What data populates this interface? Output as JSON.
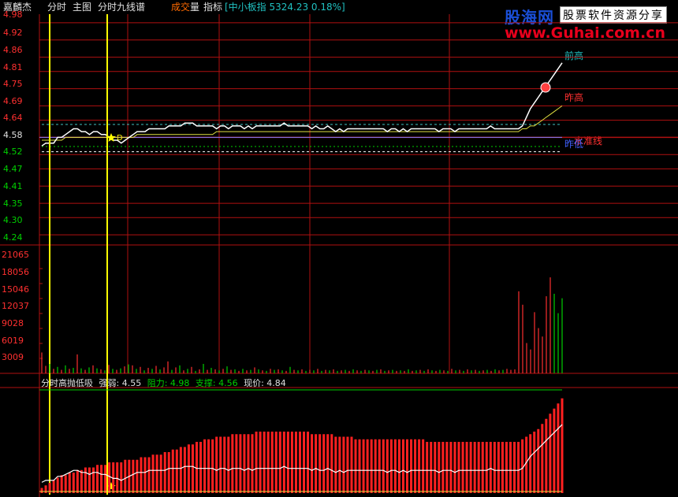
{
  "header": {
    "stock_name": "嘉麟杰",
    "menu": [
      "分时",
      "主图",
      "分时九线谱"
    ],
    "volume_menu_a": "成交",
    "volume_menu_b": "量",
    "indicator_menu": "指标",
    "index_box": "[中小板指 5324.23 0.18%]"
  },
  "logo": {
    "big": "股海网",
    "box": "股票软件资源分享",
    "url": "www.Guhai.com.cn"
  },
  "colors": {
    "price_up": "#ff3030",
    "price_down": "#00d000",
    "price_line": "#ffffff",
    "avg_line": "#e0e040",
    "grid": "#b01010",
    "marker": "#ffff00",
    "cyan": "#20c0c0"
  },
  "chart_data": [
    {
      "type": "line",
      "title": "",
      "price_ticks_up": [
        "4.98",
        "4.92",
        "4.86",
        "4.81",
        "4.75",
        "4.69",
        "4.64"
      ],
      "price_tick_mid": "4.58",
      "price_ticks_down": [
        "4.52",
        "4.47",
        "4.41",
        "4.35",
        "4.30",
        "4.24"
      ],
      "ylim": [
        4.21,
        5.01
      ],
      "prev_close": 4.58,
      "series": [
        {
          "values": [
            4.55,
            4.56,
            4.56,
            4.56,
            4.58,
            4.58,
            4.59,
            4.6,
            4.61,
            4.61,
            4.6,
            4.6,
            4.59,
            4.6,
            4.6,
            4.59,
            4.59,
            4.58,
            4.57,
            4.57,
            4.56,
            4.57,
            4.58,
            4.59,
            4.6,
            4.6,
            4.6,
            4.61,
            4.61,
            4.61,
            4.61,
            4.61,
            4.62,
            4.62,
            4.62,
            4.62,
            4.63,
            4.63,
            4.63,
            4.62,
            4.62,
            4.62,
            4.62,
            4.62,
            4.61,
            4.62,
            4.62,
            4.61,
            4.62,
            4.62,
            4.62,
            4.61,
            4.62,
            4.61,
            4.62,
            4.62,
            4.62,
            4.62,
            4.62,
            4.62,
            4.62,
            4.63,
            4.62,
            4.62,
            4.62,
            4.62,
            4.62,
            4.62,
            4.61,
            4.62,
            4.61,
            4.61,
            4.62,
            4.61,
            4.6,
            4.61,
            4.6,
            4.61,
            4.61,
            4.61,
            4.61,
            4.61,
            4.61,
            4.61,
            4.61,
            4.61,
            4.61,
            4.6,
            4.61,
            4.61,
            4.6,
            4.61,
            4.6,
            4.61,
            4.61,
            4.61,
            4.61,
            4.61,
            4.61,
            4.61,
            4.6,
            4.61,
            4.61,
            4.61,
            4.6,
            4.61,
            4.61,
            4.61,
            4.61,
            4.61,
            4.61,
            4.61,
            4.61,
            4.62,
            4.61,
            4.61,
            4.61,
            4.61,
            4.61,
            4.61,
            4.61,
            4.62,
            4.65,
            4.68,
            4.7,
            4.72,
            4.74,
            4.76,
            4.78,
            4.8,
            4.82,
            4.84
          ]
        },
        {
          "values": [
            4.57,
            4.57,
            4.57,
            4.57,
            4.57,
            4.57,
            4.58,
            4.58,
            4.58,
            4.58,
            4.58,
            4.58,
            4.58,
            4.58,
            4.58,
            4.58,
            4.58,
            4.58,
            4.58,
            4.58,
            4.58,
            4.58,
            4.58,
            4.58,
            4.59,
            4.59,
            4.59,
            4.59,
            4.59,
            4.59,
            4.59,
            4.59,
            4.59,
            4.59,
            4.59,
            4.59,
            4.59,
            4.59,
            4.59,
            4.59,
            4.59,
            4.59,
            4.59,
            4.59,
            4.6,
            4.6,
            4.6,
            4.6,
            4.6,
            4.6,
            4.6,
            4.6,
            4.6,
            4.6,
            4.6,
            4.6,
            4.6,
            4.6,
            4.6,
            4.6,
            4.6,
            4.6,
            4.6,
            4.6,
            4.6,
            4.6,
            4.6,
            4.6,
            4.6,
            4.6,
            4.6,
            4.6,
            4.6,
            4.6,
            4.6,
            4.6,
            4.6,
            4.6,
            4.6,
            4.6,
            4.6,
            4.6,
            4.6,
            4.6,
            4.6,
            4.6,
            4.6,
            4.6,
            4.6,
            4.6,
            4.6,
            4.6,
            4.6,
            4.6,
            4.6,
            4.6,
            4.6,
            4.6,
            4.6,
            4.6,
            4.6,
            4.6,
            4.6,
            4.6,
            4.6,
            4.6,
            4.6,
            4.6,
            4.6,
            4.6,
            4.6,
            4.6,
            4.6,
            4.6,
            4.6,
            4.6,
            4.6,
            4.6,
            4.6,
            4.6,
            4.6,
            4.61,
            4.61,
            4.62,
            4.62,
            4.63,
            4.64,
            4.65,
            4.66,
            4.67,
            4.68,
            4.69
          ]
        }
      ],
      "annotations": {
        "prev_high_label": "前高",
        "yesterday_high_label": "昨高",
        "yesterday_low_label": "昨低",
        "water_line_label": "水准线",
        "d_marker_label": "D"
      }
    },
    {
      "type": "bar",
      "title": "",
      "ticks": [
        "21065",
        "18056",
        "15046",
        "12037",
        "9028",
        "6019",
        "3009"
      ],
      "ylim": [
        0,
        24074
      ],
      "values": [
        4200,
        1500,
        1900,
        900,
        1300,
        700,
        1600,
        900,
        1100,
        3800,
        1000,
        700,
        1200,
        1600,
        1000,
        800,
        600,
        1700,
        900,
        700,
        1000,
        1400,
        1800,
        1600,
        900,
        1300,
        600,
        1100,
        900,
        1500,
        800,
        1200,
        2400,
        700,
        1200,
        1600,
        600,
        900,
        1300,
        500,
        800,
        1900,
        700,
        1100,
        800,
        600,
        900,
        1400,
        700,
        800,
        500,
        900,
        600,
        700,
        1200,
        800,
        600,
        500,
        900,
        700,
        800,
        600,
        500,
        1300,
        700,
        600,
        800,
        500,
        700,
        600,
        900,
        500,
        700,
        600,
        800,
        500,
        600,
        700,
        500,
        800,
        600,
        500,
        700,
        600,
        500,
        700,
        800,
        500,
        600,
        700,
        500,
        600,
        500,
        800,
        500,
        600,
        700,
        500,
        800,
        600,
        500,
        700,
        600,
        500,
        900,
        600,
        700,
        500,
        800,
        600,
        700,
        500,
        600,
        700,
        500,
        800,
        600,
        700,
        900,
        700,
        800,
        16500,
        13800,
        6100,
        4800,
        12300,
        9100,
        7400,
        15500,
        19300,
        16000,
        12100,
        15100
      ],
      "up": [
        true,
        true,
        false,
        true,
        false,
        true,
        false,
        true,
        false,
        true,
        false,
        true,
        false,
        true,
        false,
        true,
        false,
        true,
        false,
        true,
        false,
        true,
        false,
        true,
        false,
        true,
        false,
        true,
        false,
        true,
        false,
        true,
        true,
        false,
        true,
        false,
        true,
        false,
        true,
        false,
        true,
        false,
        true,
        false,
        true,
        false,
        true,
        false,
        true,
        false,
        true,
        false,
        true,
        false,
        true,
        false,
        true,
        false,
        true,
        false,
        true,
        false,
        true,
        false,
        true,
        false,
        true,
        false,
        true,
        false,
        true,
        false,
        true,
        false,
        true,
        false,
        true,
        false,
        true,
        false,
        true,
        false,
        true,
        false,
        true,
        false,
        true,
        false,
        true,
        false,
        true,
        false,
        true,
        false,
        true,
        false,
        true,
        false,
        true,
        false,
        true,
        false,
        true,
        false,
        true,
        false,
        true,
        false,
        true,
        false,
        true,
        false,
        true,
        false,
        true,
        false,
        true,
        false,
        true,
        true,
        true,
        true,
        true,
        true,
        true,
        true,
        true,
        true,
        true,
        true
      ]
    },
    {
      "type": "bar",
      "title": "",
      "indicator_name": "分时高抛低吸",
      "strength_label": "强弱: 4.55",
      "resistance_label": "阻力: 4.98",
      "support_label": "支撑: 4.56",
      "price_label": "现价: 4.84",
      "values": [
        2,
        3,
        4,
        5,
        6,
        7,
        7,
        8,
        8,
        9,
        9,
        10,
        10,
        10,
        11,
        11,
        11,
        12,
        12,
        12,
        12,
        13,
        13,
        13,
        13,
        14,
        14,
        14,
        15,
        15,
        15,
        16,
        16,
        17,
        17,
        18,
        18,
        19,
        19,
        20,
        20,
        21,
        21,
        21,
        22,
        22,
        22,
        22,
        23,
        23,
        23,
        23,
        23,
        23,
        24,
        24,
        24,
        24,
        24,
        24,
        24,
        24,
        24,
        24,
        24,
        24,
        24,
        24,
        23,
        23,
        23,
        23,
        23,
        23,
        22,
        22,
        22,
        22,
        22,
        21,
        21,
        21,
        21,
        21,
        21,
        21,
        21,
        21,
        21,
        21,
        21,
        21,
        21,
        21,
        21,
        21,
        21,
        20,
        20,
        20,
        20,
        20,
        20,
        20,
        20,
        20,
        20,
        20,
        20,
        20,
        20,
        20,
        20,
        20,
        20,
        20,
        20,
        20,
        20,
        20,
        20,
        21,
        22,
        23,
        24,
        25,
        27,
        29,
        31,
        33,
        35,
        37
      ]
    }
  ]
}
